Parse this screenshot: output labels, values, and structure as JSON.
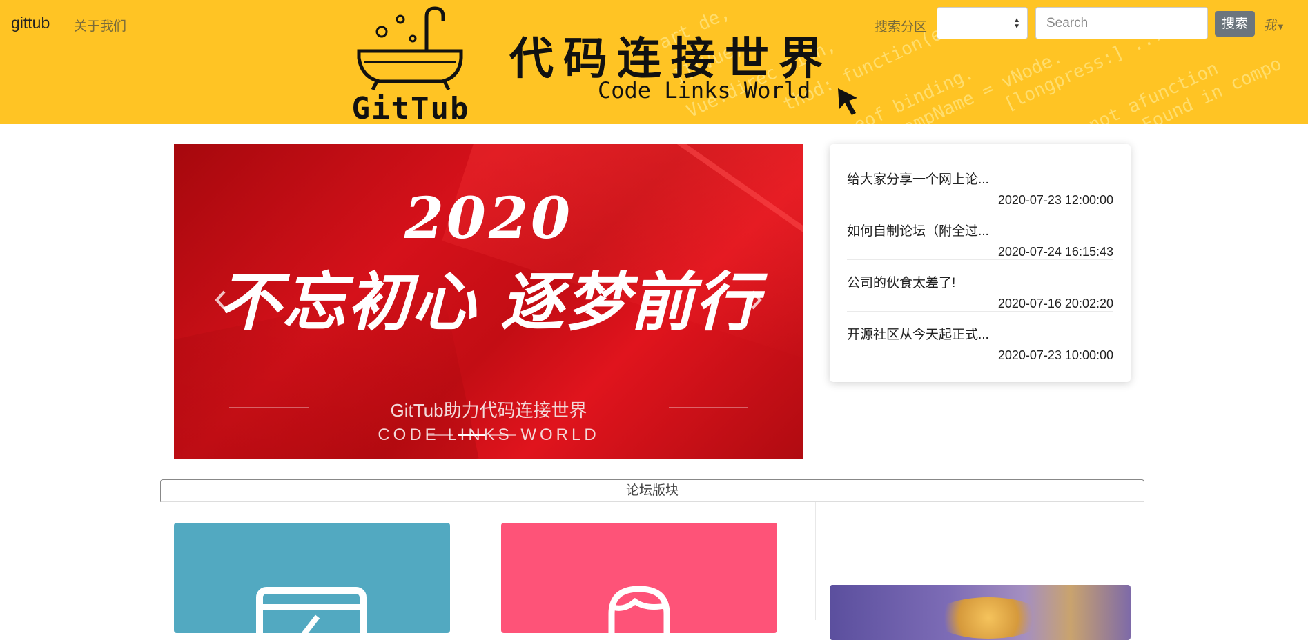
{
  "navbar": {
    "brand": "gittub",
    "about": "关于我们",
    "search_label": "搜索分区",
    "search_select_value": "",
    "search_placeholder": "Search",
    "search_button": "搜索",
    "user_menu": "我",
    "accent_color": "#ffc424"
  },
  "banner": {
    "logo_text": "GitTub",
    "slogan_cn": "代码连接世界",
    "slogan_en": "Code Links World",
    "icons": [
      "bathtub-logo-icon",
      "cursor-arrow-icon"
    ]
  },
  "carousel": {
    "year": "2020",
    "headline": "不忘初心 逐梦前行",
    "subtitle_cn": "GitTub助力代码连接世界",
    "subtitle_en": "CODE LINKS WORLD",
    "prev_icon": "chevron-left-icon",
    "next_icon": "chevron-right-icon",
    "slide_count": 3,
    "active_slide": 1
  },
  "latest_posts": [
    {
      "title": "给大家分享一个网上论...",
      "time": "2020-07-23 12:00:00"
    },
    {
      "title": "如何自制论坛（附全过...",
      "time": "2020-07-24 16:15:43"
    },
    {
      "title": "公司的伙食太差了!",
      "time": "2020-07-16 20:02:20"
    },
    {
      "title": "开源社区从今天起正式...",
      "time": "2020-07-23 10:00:00"
    }
  ],
  "forum_section": {
    "title": "论坛版块",
    "tiles": [
      {
        "icon": "document-edit-icon",
        "color": "#52a9c1"
      },
      {
        "icon": "user-avatar-icon",
        "color": "#fe5378"
      }
    ]
  }
}
